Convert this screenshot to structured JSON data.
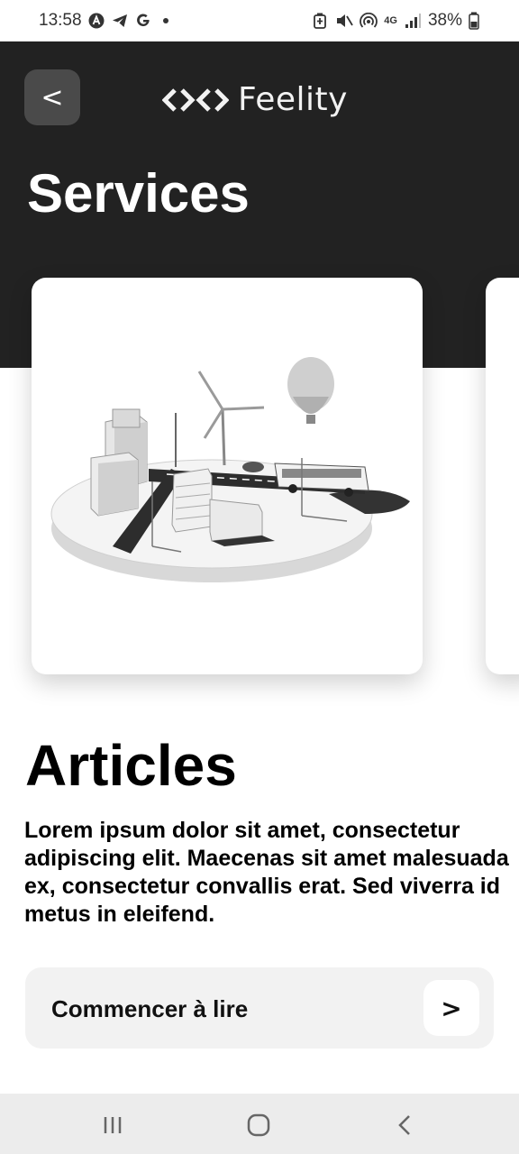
{
  "status_bar": {
    "time": "13:58",
    "left_icons": [
      "a-badge-icon",
      "telegram-icon",
      "google-icon",
      "notification-dot-icon"
    ],
    "right_icons": [
      "battery-saver-icon",
      "mute-icon",
      "hotspot-icon",
      "network-4g-icon",
      "signal-icon"
    ],
    "network": "4G",
    "battery": "38%"
  },
  "header": {
    "back_label": "<",
    "brand": "Feelity",
    "title": "Services"
  },
  "carousel": {
    "cards": [
      {
        "image": "smart-city-illustration"
      }
    ]
  },
  "section": {
    "title": "Articles",
    "description": "Lorem ipsum dolor sit amet, consectetur adipiscing elit. Maecenas sit amet malesuada ex, consectetur convallis erat. Sed viverra id metus in eleifend."
  },
  "cta": {
    "label": "Commencer à lire",
    "arrow": ">"
  },
  "nav_bar": {
    "buttons": [
      "recent-apps-icon",
      "home-icon",
      "back-nav-icon"
    ]
  },
  "colors": {
    "header_bg": "#222222",
    "back_button_bg": "#4a4a4a",
    "cta_bg": "#f2f2f2",
    "nav_bg": "#ececec"
  }
}
